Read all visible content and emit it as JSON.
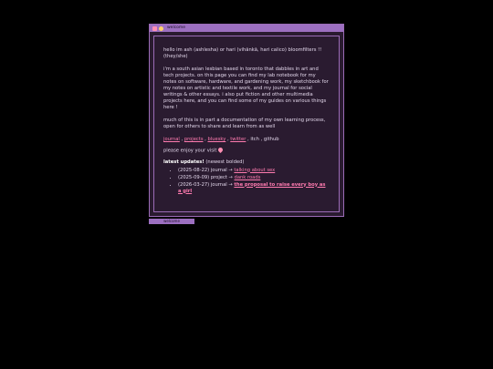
{
  "window": {
    "title": "welcome",
    "icons": [
      "heart-icon",
      "face-icon"
    ]
  },
  "content": {
    "intro": "hello im ash (ashlesha) or hari (vihānkā, hari calico) bloomfilters !! (they/she)",
    "bio": "i'm a south asian lesbian based in toronto that dabbles in art and tech projects. on this page you can find my lab notebook for my notes on software, hardware, and gardening work, my sketchbook for my notes on artistic and textile work, and my journal for social writings & other essays. i also put fiction and other multimedia projects here, and you can find some of my guides on various things here !",
    "documentation": "much of this is in part a documentation of my own learning process, open for others to share and learn from as well",
    "links": [
      {
        "label": "journal"
      },
      {
        "label": "projects"
      },
      {
        "label": "bluesky"
      },
      {
        "label": "twitter"
      },
      {
        "label": "itch"
      },
      {
        "label": "github"
      }
    ],
    "enjoy": "please enjoy your visit",
    "updates_heading": "latest updates!",
    "updates_sub": "(newest bolded)",
    "updates": [
      {
        "date": "(2025-08-22)",
        "kind": "journal",
        "arrow": "→",
        "title": "talking about sex"
      },
      {
        "date": "(2025-09-09)",
        "kind": "project",
        "arrow": "→",
        "title": "dank roads"
      },
      {
        "date": "(2026-03-27)",
        "kind": "journal",
        "arrow": "→",
        "title": "the proposal to raise every boy as a girl"
      }
    ]
  },
  "taskbar": {
    "label": "welcome"
  },
  "colors": {
    "background": "#000000",
    "window_bg": "#2a1b30",
    "titlebar": "#9c6fc0",
    "link": "#ff7bb0",
    "text": "#e2d6ea"
  }
}
